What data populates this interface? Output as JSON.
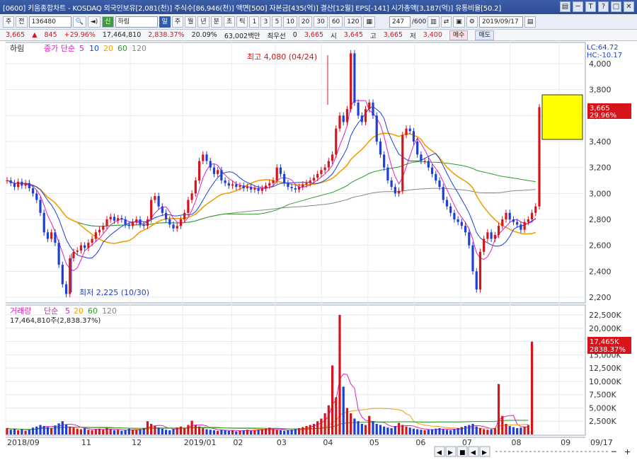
{
  "window": {
    "title": "[0600] 키움종합차트 - KOSDAQ 외국인보유[2,081(천)] 주식수[86,946(천)] 액면[500] 자본금[435(억)] 결산[12월] EPS[-141] 시가총액[3,187(억)] 유통비율[50.2]",
    "buttons": [
      "▤",
      "─",
      "T",
      "?",
      "□",
      "✕"
    ]
  },
  "toolbar": {
    "period": "주",
    "view": "전",
    "code": "136480",
    "stock_name": "하림",
    "timeframe": [
      "일",
      "주",
      "월",
      "년",
      "분",
      "초",
      "틱",
      "1",
      "3",
      "5",
      "10",
      "20",
      "30",
      "60",
      "120"
    ],
    "selected_timeframe": "일",
    "count": "247",
    "count_total": "/600",
    "date": "2019/09/17"
  },
  "quote": {
    "price": "3,665",
    "change": "845",
    "change_pct": "+29.96%",
    "volume": "17,464,810",
    "volume_pct": "2,838.37%",
    "turnover": "20.09%",
    "amount": "63,002백만",
    "priority_label": "최우선",
    "priority_value": "0",
    "last": "3,665",
    "open_label": "시",
    "open": "3,645",
    "high_label": "고",
    "high": "3,665",
    "low_label": "저",
    "low": "3,400",
    "buy": "매수",
    "sell": "매도"
  },
  "price_panel": {
    "stock_label": "하림",
    "ma_label": "종가 단순",
    "ma_periods": [
      "5",
      "10",
      "20",
      "60",
      "120"
    ],
    "lc": "LC:64.72",
    "hc": "HC:-10.17",
    "last_price": "3,665",
    "last_pct": "29.96%",
    "high_annot": "최고 4,080 (04/24)",
    "low_annot": "최저 2,225 (10/30)"
  },
  "volume_panel": {
    "label": "거래량",
    "ma_label": "단순",
    "ma_periods": [
      "5",
      "20",
      "60",
      "120"
    ],
    "value_text": "17,464,810주(2,838.37%)",
    "last_volume": "17,465K",
    "last_pct": "2838.37%"
  },
  "x_axis": [
    "2018/09",
    "11",
    "12",
    "2019/01",
    "02",
    "03",
    "04",
    "05",
    "06",
    "07",
    "08",
    "09",
    "09/17"
  ],
  "bottom_controls": [
    "◀",
    "▶",
    "■",
    "◀",
    "▶",
    "─",
    "+"
  ],
  "colors": {
    "up": "#d7141a",
    "down": "#1d3fd8",
    "ma5": "#e020c0",
    "ma10": "#1d3fd8",
    "ma20": "#f0a000",
    "ma60": "#2a9d2a",
    "ma120": "#888888",
    "highlight": "#ffff00"
  },
  "chart_data": {
    "type": "line",
    "price_axis": {
      "range": [
        2200,
        4000
      ],
      "ticks": [
        "4,000",
        "3,800",
        "3,600",
        "3,400",
        "3,200",
        "3,000",
        "2,800",
        "2,600",
        "2,400",
        "2,200"
      ]
    },
    "volume_axis": {
      "range": [
        0,
        22500
      ],
      "ticks": [
        "22,500K",
        "20,000K",
        "17,500K",
        "15,000K",
        "12,500K",
        "10,000K",
        "7,500K",
        "5,000K",
        "2,500K"
      ]
    },
    "close": [
      3100,
      3080,
      3050,
      3090,
      3060,
      3080,
      3040,
      3000,
      2950,
      2850,
      2700,
      2650,
      2700,
      2620,
      2450,
      2300,
      2225,
      2500,
      2550,
      2560,
      2600,
      2580,
      2620,
      2650,
      2700,
      2720,
      2750,
      2800,
      2820,
      2790,
      2810,
      2800,
      2760,
      2750,
      2780,
      2800,
      2760,
      2750,
      2800,
      2950,
      2980,
      2900,
      2850,
      2800,
      2760,
      2730,
      2750,
      2800,
      2850,
      2950,
      3000,
      3100,
      3250,
      3300,
      3250,
      3200,
      3150,
      3180,
      3100,
      3080,
      3060,
      3070,
      3050,
      3060,
      3040,
      3050,
      3030,
      3040,
      3020,
      3040,
      3060,
      3080,
      3100,
      3200,
      3150,
      3080,
      3050,
      3040,
      3030,
      3050,
      3070,
      3080,
      3100,
      3120,
      3150,
      3180,
      3200,
      3250,
      3300,
      3500,
      3600,
      3550,
      3650,
      4080,
      3700,
      3600,
      3550,
      3650,
      3700,
      3600,
      3400,
      3300,
      3200,
      3100,
      3050,
      3000,
      3020,
      3450,
      3500,
      3480,
      3400,
      3300,
      3250,
      3250,
      3200,
      3150,
      3100,
      3050,
      2950,
      2900,
      2850,
      2800,
      2780,
      2750,
      2700,
      2600,
      2400,
      2260,
      2550,
      2650,
      2700,
      2650,
      2680,
      2750,
      2800,
      2850,
      2800,
      2780,
      2760,
      2720,
      2780,
      2800,
      2850,
      2900,
      3665
    ],
    "volume": [
      1200,
      900,
      1100,
      800,
      1000,
      700,
      900,
      1300,
      1500,
      1800,
      1600,
      1400,
      1200,
      1700,
      2100,
      2500,
      1900,
      1500,
      1300,
      1100,
      1000,
      1200,
      900,
      800,
      1000,
      1100,
      900,
      1200,
      1000,
      800,
      900,
      700,
      800,
      1100,
      900,
      800,
      1000,
      1200,
      2500,
      2000,
      1600,
      1300,
      1100,
      900,
      800,
      1000,
      1300,
      1500,
      1200,
      1800,
      2600,
      1800,
      1500,
      1200,
      1000,
      900,
      800,
      700,
      900,
      800,
      700,
      800,
      600,
      700,
      800,
      900,
      700,
      800,
      900,
      1000,
      1100,
      1300,
      1000,
      900,
      800,
      700,
      800,
      900,
      1000,
      1200,
      1400,
      1600,
      1800,
      2000,
      2500,
      3000,
      4000,
      5500,
      13000,
      7000,
      22500,
      9000,
      5000,
      4000,
      3000,
      2500,
      2000,
      1800,
      3500,
      2500,
      2000,
      1800,
      1500,
      1300,
      1200,
      1600,
      2200,
      1800,
      1500,
      1300,
      1100,
      1000,
      900,
      800,
      900,
      1000,
      1100,
      1200,
      1000,
      900,
      800,
      1000,
      1200,
      1400,
      1600,
      1800,
      2000,
      1500,
      1200,
      1000,
      900,
      1000,
      1200,
      9500,
      3500,
      2000,
      1600,
      1400,
      1200,
      1300,
      1500,
      1800,
      17465
    ]
  }
}
